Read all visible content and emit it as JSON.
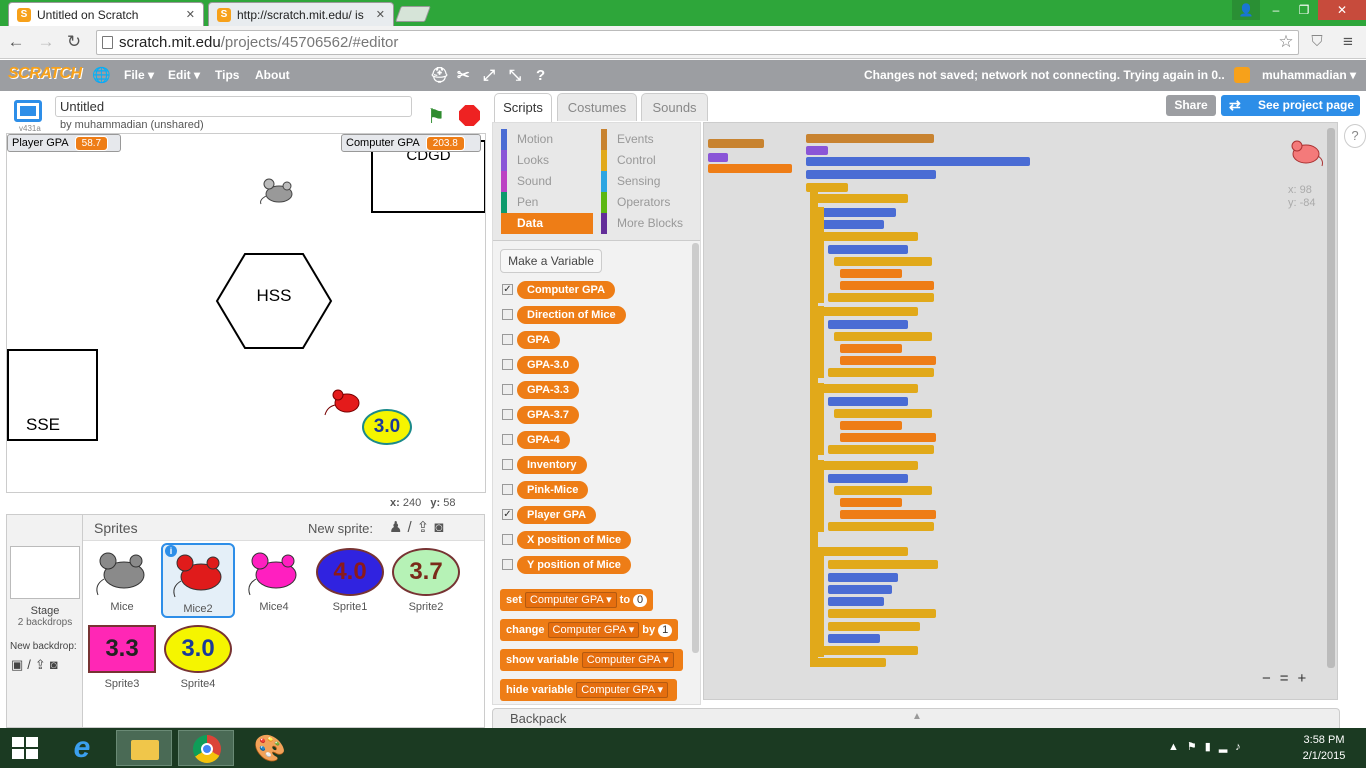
{
  "browser": {
    "tabs": [
      {
        "title": "Untitled on Scratch",
        "favicon": "S"
      },
      {
        "title": "http://scratch.mit.edu/ is",
        "favicon": "S"
      }
    ],
    "url_host": "scratch.mit.edu",
    "url_path": "/projects/45706562/#editor"
  },
  "menubar": {
    "logo": "SCRATCH",
    "items": [
      "File ▾",
      "Edit ▾",
      "Tips",
      "About"
    ],
    "status": "Changes not saved; network not connecting. Trying again in 0...",
    "username": "muhammadian ▾"
  },
  "project": {
    "title": "Untitled",
    "author": "by muhammadian (unshared)",
    "version": "v431a",
    "share_label": "Share",
    "see_project_label": "See project page"
  },
  "stage": {
    "monitors": [
      {
        "label": "Player GPA",
        "value": "58.7"
      },
      {
        "label": "Computer GPA",
        "value": "203.8"
      }
    ],
    "labels": {
      "hss": "HSS",
      "sse": "SSE",
      "cdgd": "CDGD",
      "ball": "3.0"
    },
    "coords": {
      "x_label": "x:",
      "x": "240",
      "y_label": "y:",
      "y": "58"
    }
  },
  "sprites_pane": {
    "title": "Sprites",
    "new_sprite_label": "New sprite:",
    "stage_label": "Stage",
    "backdrops": "2 backdrops",
    "new_backdrop_label": "New backdrop:",
    "sprites": [
      {
        "name": "Mice",
        "kind": "mouse",
        "color": "#8a8a8a"
      },
      {
        "name": "Mice2",
        "kind": "mouse",
        "color": "#e01b1b"
      },
      {
        "name": "Mice4",
        "kind": "mouse",
        "color": "#ff1fc0"
      },
      {
        "name": "Sprite1",
        "kind": "badge",
        "text": "4.0",
        "color": "#3023e0",
        "text_color": "#8b1a1a"
      },
      {
        "name": "Sprite2",
        "kind": "badge",
        "text": "3.7",
        "color": "#b6f2b6",
        "text_color": "#7a2a1a"
      },
      {
        "name": "Sprite3",
        "kind": "square",
        "text": "3.3",
        "color": "#ff27b5",
        "text_color": "#222"
      },
      {
        "name": "Sprite4",
        "kind": "badge",
        "text": "3.0",
        "color": "#f5f500",
        "text_color": "#1a3a9a"
      }
    ]
  },
  "editor_tabs": [
    "Scripts",
    "Costumes",
    "Sounds"
  ],
  "categories": [
    {
      "name": "Motion",
      "color": "#4a6cd4"
    },
    {
      "name": "Events",
      "color": "#c88330"
    },
    {
      "name": "Looks",
      "color": "#8a55d7"
    },
    {
      "name": "Control",
      "color": "#e1a91a"
    },
    {
      "name": "Sound",
      "color": "#bb42c3"
    },
    {
      "name": "Sensing",
      "color": "#2ca5e2"
    },
    {
      "name": "Pen",
      "color": "#0e9a6c"
    },
    {
      "name": "Operators",
      "color": "#5cb712"
    },
    {
      "name": "Data",
      "color": "#ee7d16"
    },
    {
      "name": "More Blocks",
      "color": "#632d99"
    }
  ],
  "palette": {
    "make_variable": "Make a Variable",
    "variables": [
      {
        "name": "Computer GPA",
        "checked": true
      },
      {
        "name": "Direction of Mice",
        "checked": false
      },
      {
        "name": "GPA",
        "checked": false
      },
      {
        "name": "GPA-3.0",
        "checked": false
      },
      {
        "name": "GPA-3.3",
        "checked": false
      },
      {
        "name": "GPA-3.7",
        "checked": false
      },
      {
        "name": "GPA-4",
        "checked": false
      },
      {
        "name": "Inventory",
        "checked": false
      },
      {
        "name": "Pink-Mice",
        "checked": false
      },
      {
        "name": "Player GPA",
        "checked": true
      },
      {
        "name": "X position of Mice",
        "checked": false
      },
      {
        "name": "Y position of Mice",
        "checked": false
      }
    ],
    "commands": [
      {
        "verb": "set",
        "var": "Computer GPA",
        "mid": "to",
        "value": "0"
      },
      {
        "verb": "change",
        "var": "Computer GPA",
        "mid": "by",
        "value": "1"
      },
      {
        "verb": "show variable",
        "var": "Computer GPA",
        "mid": "",
        "value": ""
      },
      {
        "verb": "hide variable",
        "var": "Computer GPA",
        "mid": "",
        "value": ""
      }
    ]
  },
  "script_area": {
    "sprite_x_label": "x:",
    "sprite_x": "98",
    "sprite_y_label": "y:",
    "sprite_y": "-84"
  },
  "backpack_label": "Backpack",
  "taskbar": {
    "time": "3:58 PM",
    "date": "2/1/2015"
  },
  "colors": {
    "scratch_orange": "#ee7d16",
    "menubar_gray": "#9c9ea2",
    "taskbar_green": "#1b3a22",
    "chrome_green": "#2ea63a",
    "share_blue": "#2d8ee8"
  }
}
